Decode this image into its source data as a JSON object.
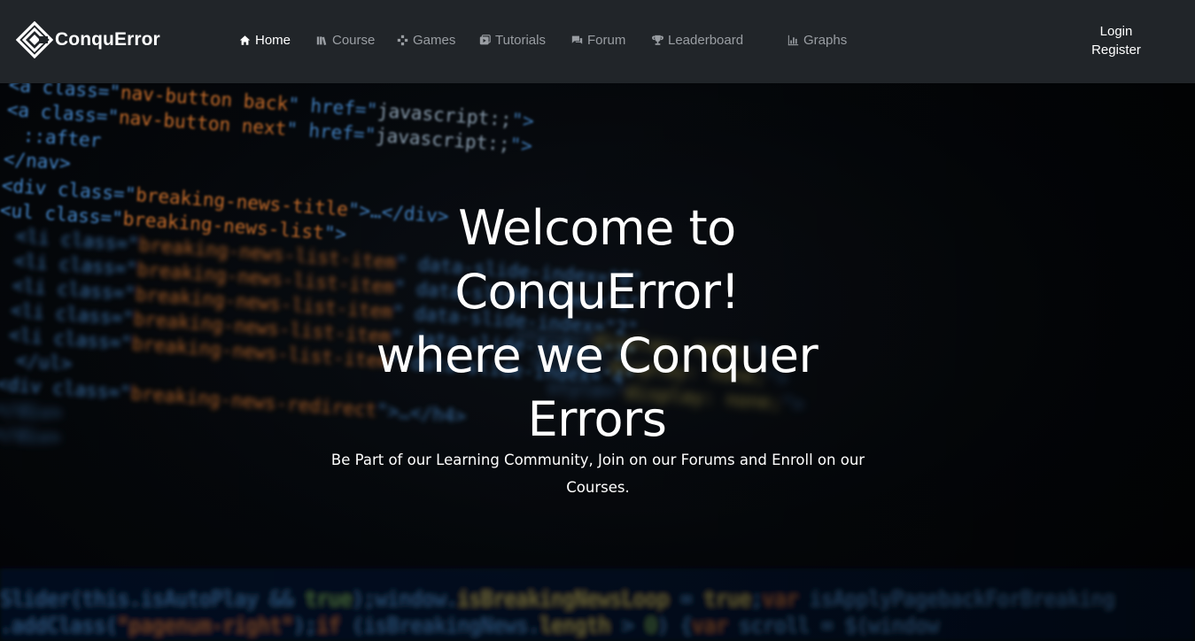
{
  "brand": {
    "name": "ConquError",
    "logo_icon": "diamond-c-logo"
  },
  "nav": [
    {
      "label": "Home",
      "icon": "home-icon",
      "active": true
    },
    {
      "label": "Course",
      "icon": "books-icon",
      "active": false
    },
    {
      "label": "Games",
      "icon": "gamepad-icon",
      "active": false
    },
    {
      "label": "Tutorials",
      "icon": "video-icon",
      "active": false
    },
    {
      "label": "Forum",
      "icon": "chat-icon",
      "active": false
    },
    {
      "label": "Leaderboard",
      "icon": "trophy-icon",
      "active": false
    },
    {
      "label": "Graphs",
      "icon": "bar-chart-icon",
      "active": false
    }
  ],
  "auth": {
    "login_label": "Login",
    "register_label": "Register"
  },
  "hero": {
    "title_line1": "Welcome to",
    "title_line2": "ConquError!",
    "title_line3": "where we Conquer",
    "title_line4": "Errors",
    "subtitle_line1": "Be Part of our Learning Community, Join on our Forums and Enroll on our",
    "subtitle_line2": "Courses."
  },
  "colors": {
    "navbar_bg": "#212529",
    "nav_text": "#9a9ea3",
    "nav_active": "#ffffff",
    "code_orange": "#d9772e",
    "code_blue": "#4a8fd6",
    "code_green": "#7fbf5a",
    "code_yellow": "#e8d25c"
  }
}
